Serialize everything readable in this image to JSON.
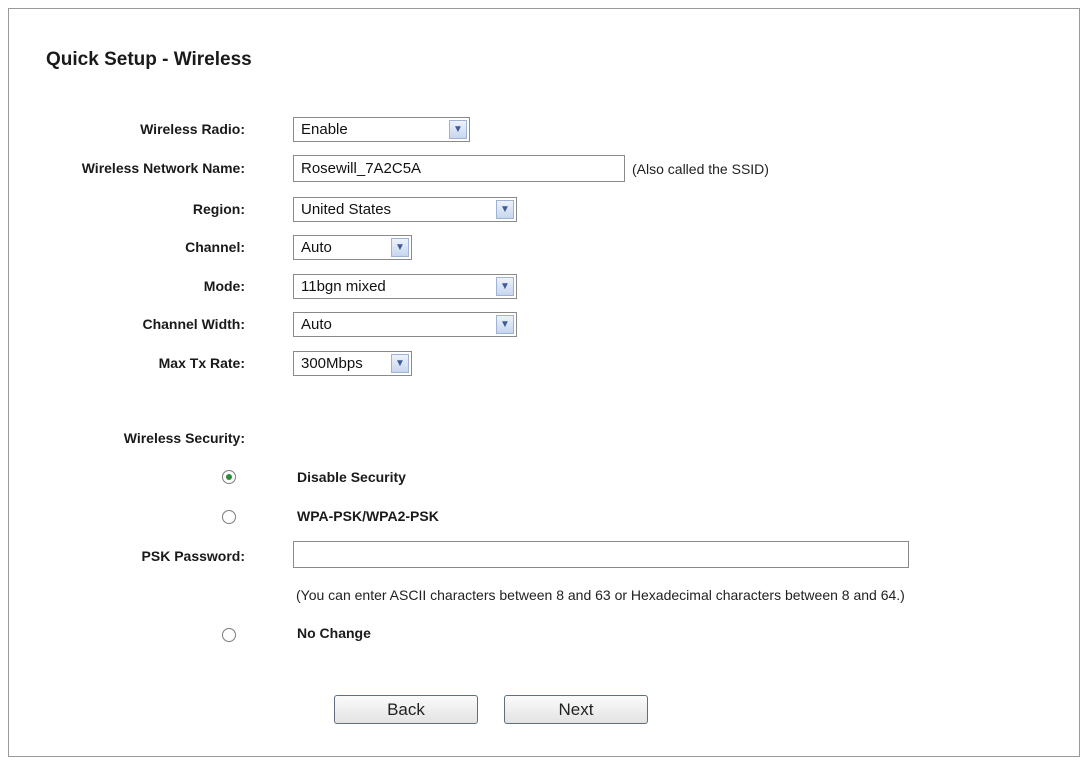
{
  "page": {
    "title": "Quick Setup - Wireless"
  },
  "fields": {
    "wireless_radio": {
      "label": "Wireless Radio:",
      "value": "Enable"
    },
    "network_name": {
      "label": "Wireless Network Name:",
      "value": "Rosewill_7A2C5A",
      "hint": "(Also called the SSID)"
    },
    "region": {
      "label": "Region:",
      "value": "United States"
    },
    "channel": {
      "label": "Channel:",
      "value": "Auto"
    },
    "mode": {
      "label": "Mode:",
      "value": "11bgn mixed"
    },
    "channel_width": {
      "label": "Channel Width:",
      "value": "Auto"
    },
    "max_tx_rate": {
      "label": "Max Tx Rate:",
      "value": "300Mbps"
    }
  },
  "security": {
    "heading": "Wireless Security:",
    "options": [
      {
        "label": "Disable Security",
        "checked": true
      },
      {
        "label": "WPA-PSK/WPA2-PSK",
        "checked": false
      },
      {
        "label": "No Change",
        "checked": false
      }
    ],
    "psk_label": "PSK Password:",
    "psk_value": "",
    "psk_hint": "(You can enter ASCII characters between 8 and 63 or Hexadecimal characters between 8 and 64.)"
  },
  "buttons": {
    "back": "Back",
    "next": "Next"
  },
  "icons": {
    "dropdown": "chevron-down-icon",
    "radio_selected_color": "#2e8b3a"
  }
}
